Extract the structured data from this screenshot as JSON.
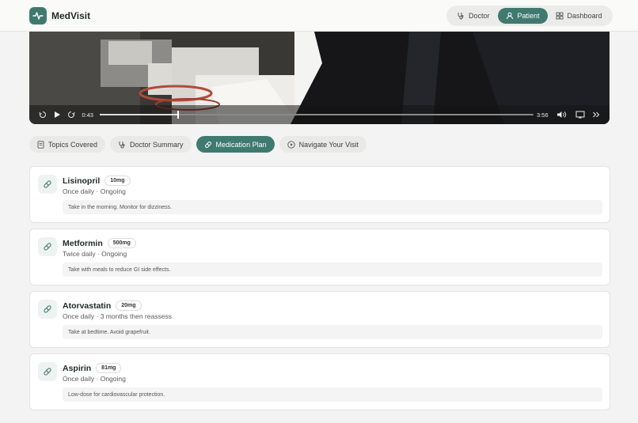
{
  "app": {
    "name": "MedVisit"
  },
  "roles": [
    {
      "label": "Doctor",
      "active": false
    },
    {
      "label": "Patient",
      "active": true
    },
    {
      "label": "Dashboard",
      "active": false
    }
  ],
  "video": {
    "current_time": "0:43",
    "duration": "3:56",
    "progress": 0.18
  },
  "tabs": [
    {
      "label": "Topics Covered",
      "icon": "document-icon",
      "active": false
    },
    {
      "label": "Doctor Summary",
      "icon": "stethoscope-icon",
      "active": false
    },
    {
      "label": "Medication Plan",
      "icon": "pill-icon",
      "active": true
    },
    {
      "label": "Navigate Your Visit",
      "icon": "play-circle-icon",
      "active": false
    }
  ],
  "medications": [
    {
      "name": "Lisinopril",
      "dose": "10mg",
      "schedule": "Once daily · Ongoing",
      "note": "Take in the morning. Monitor for dizziness."
    },
    {
      "name": "Metformin",
      "dose": "500mg",
      "schedule": "Twice daily · Ongoing",
      "note": "Take with meals to reduce GI side effects."
    },
    {
      "name": "Atorvastatin",
      "dose": "20mg",
      "schedule": "Once daily · 3 months then reassess",
      "note": "Take at bedtime. Avoid grapefruit."
    },
    {
      "name": "Aspirin",
      "dose": "81mg",
      "schedule": "Once daily · Ongoing",
      "note": "Low-dose for cardiovascular protection."
    }
  ],
  "colors": {
    "accent": "#3f7a70",
    "background": "#f2f3f2"
  }
}
